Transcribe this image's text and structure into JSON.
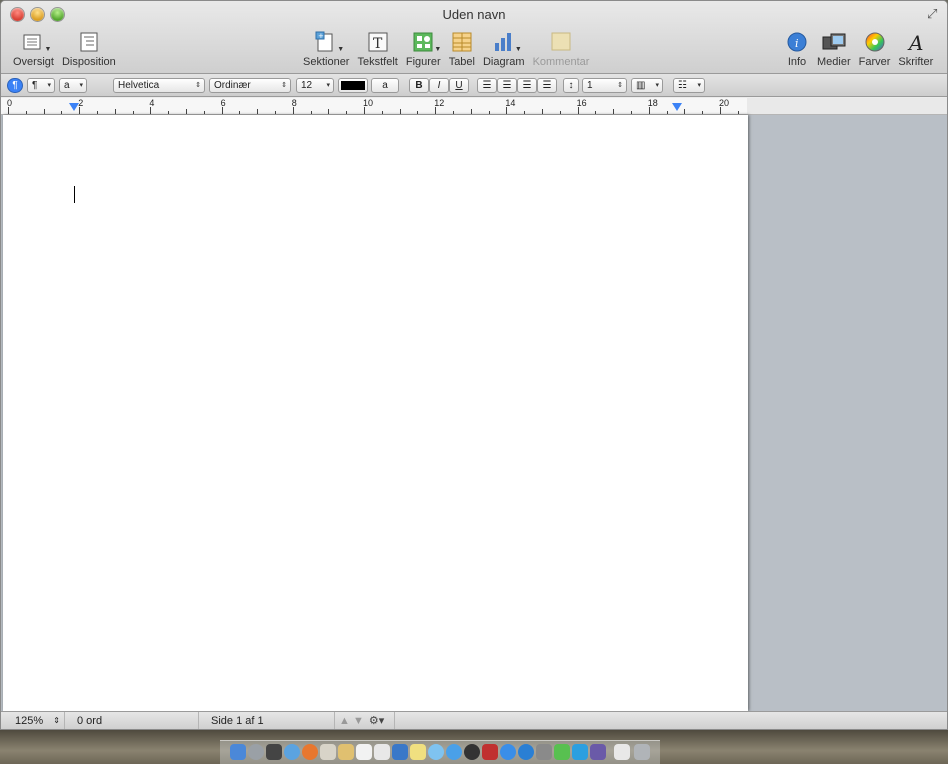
{
  "window": {
    "title": "Uden navn"
  },
  "toolbar": {
    "left": [
      {
        "label": "Oversigt",
        "icon": "view-icon"
      },
      {
        "label": "Disposition",
        "icon": "outline-icon"
      }
    ],
    "center": [
      {
        "label": "Sektioner",
        "icon": "sections-icon"
      },
      {
        "label": "Tekstfelt",
        "icon": "textbox-icon"
      },
      {
        "label": "Figurer",
        "icon": "shapes-icon"
      },
      {
        "label": "Tabel",
        "icon": "table-icon"
      },
      {
        "label": "Diagram",
        "icon": "chart-icon"
      },
      {
        "label": "Kommentar",
        "icon": "comment-icon",
        "disabled": true
      }
    ],
    "right": [
      {
        "label": "Info",
        "icon": "info-icon"
      },
      {
        "label": "Medier",
        "icon": "media-icon"
      },
      {
        "label": "Farver",
        "icon": "colors-icon"
      },
      {
        "label": "Skrifter",
        "icon": "fonts-icon"
      }
    ]
  },
  "format_bar": {
    "paragraph_style": "¶",
    "character_style": "a",
    "font_family": "Helvetica",
    "font_style": "Ordinær",
    "font_size": "12",
    "text_color": "#000000",
    "highlight_label": "a",
    "bold": "B",
    "italic": "I",
    "underline": "U",
    "line_spacing": "1"
  },
  "ruler": {
    "labels": [
      "0",
      "2",
      "4",
      "6",
      "8",
      "10",
      "12",
      "14",
      "16",
      "18",
      "20"
    ]
  },
  "status_bar": {
    "zoom": "125%",
    "word_count": "0 ord",
    "page_info": "Side 1 af 1"
  },
  "colors": {
    "doc_background": "#b9bfc6",
    "accent": "#3b82f6"
  }
}
